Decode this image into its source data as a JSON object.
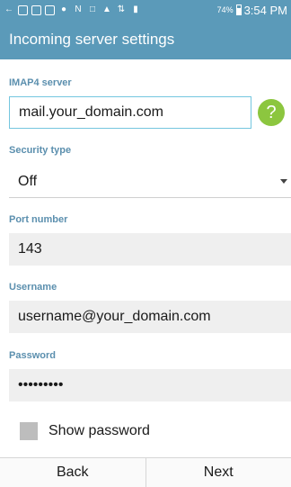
{
  "status_bar": {
    "icons": [
      "back-arrow-icon",
      "sim-icon",
      "calendar-icon",
      "storage-icon",
      "bluetooth-icon",
      "nfc-icon",
      "screenshot-icon",
      "wifi-icon",
      "lte-icon",
      "signal-icon"
    ],
    "battery_percent": "74%",
    "time": "3:54 PM"
  },
  "header": {
    "title": "Incoming server settings"
  },
  "form": {
    "server": {
      "label": "IMAP4 server",
      "value": "mail.your_domain.com"
    },
    "security": {
      "label": "Security type",
      "value": "Off"
    },
    "port": {
      "label": "Port number",
      "value": "143"
    },
    "username": {
      "label": "Username",
      "value": "username@your_domain.com"
    },
    "password": {
      "label": "Password",
      "value": "•••••••••"
    },
    "show_password": {
      "label": "Show password",
      "checked": false
    }
  },
  "help_button": {
    "glyph": "?"
  },
  "bottom_bar": {
    "back_label": "Back",
    "next_label": "Next"
  },
  "colors": {
    "header": "#5b9ab9",
    "label": "#5b8fae",
    "active_border": "#74c6df",
    "help_button": "#8cc63f",
    "field_bg": "#efefef"
  }
}
